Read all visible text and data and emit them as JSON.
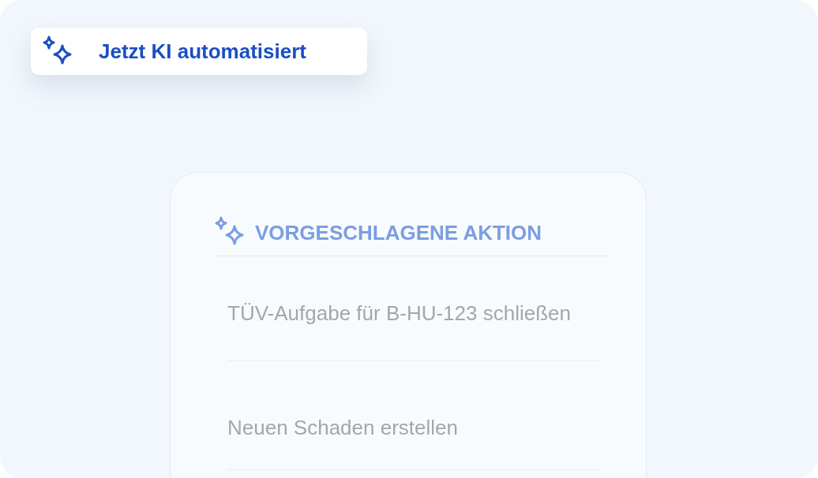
{
  "badge": {
    "label": "Jetzt KI automatisiert"
  },
  "card": {
    "title": "VORGESCHLAGENE AKTION",
    "actions": [
      {
        "label": "TÜV-Aufgabe für B-HU-123 schließen"
      },
      {
        "label": "Neuen Schaden erstellen"
      }
    ]
  }
}
